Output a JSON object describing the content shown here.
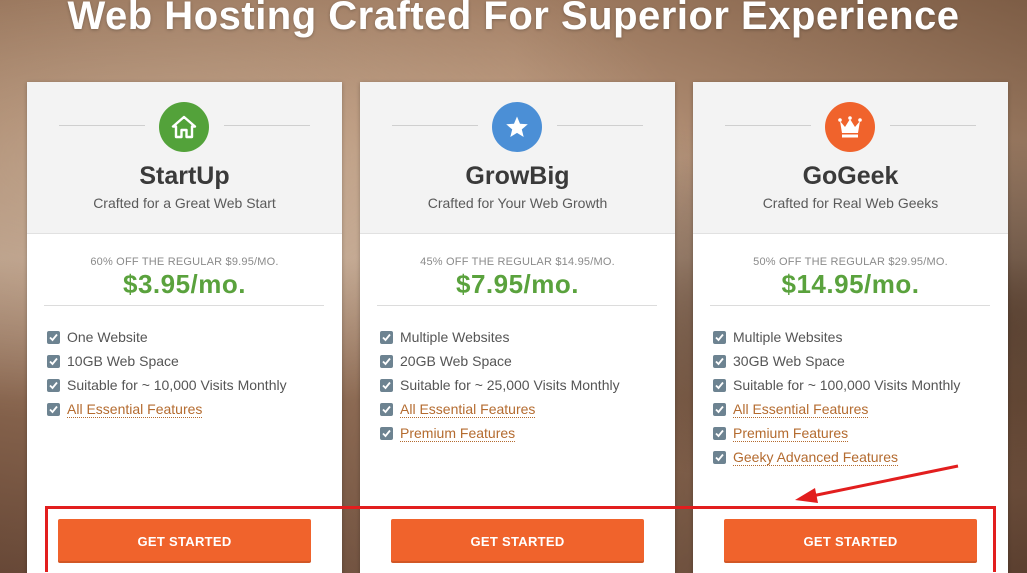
{
  "headline": "Web Hosting Crafted For Superior Experience",
  "colors": {
    "startup_icon": "#53a23a",
    "growbig_icon": "#4b8fd6",
    "gogeek_icon": "#f0632c",
    "price_green": "#5aa23d",
    "cta_orange": "#f0632c",
    "annotation_red": "#e21e1e"
  },
  "plans": [
    {
      "icon": "house-icon",
      "name": "StartUp",
      "tagline": "Crafted for a Great Web Start",
      "discount": "60% OFF THE REGULAR $9.95/MO.",
      "price": "$3.95/mo.",
      "features": [
        {
          "text": "One Website"
        },
        {
          "text": "10GB Web Space"
        },
        {
          "text": "Suitable for ~ 10,000 Visits Monthly"
        },
        {
          "text": "All Essential Features"
        }
      ],
      "cta": "GET STARTED"
    },
    {
      "icon": "star-icon",
      "name": "GrowBig",
      "tagline": "Crafted for Your Web Growth",
      "discount": "45% OFF THE REGULAR $14.95/MO.",
      "price": "$7.95/mo.",
      "features": [
        {
          "text": "Multiple Websites"
        },
        {
          "text": "20GB Web Space"
        },
        {
          "text": "Suitable for ~ 25,000 Visits Monthly"
        },
        {
          "text": "All Essential Features"
        },
        {
          "text": "Premium Features"
        }
      ],
      "cta": "GET STARTED"
    },
    {
      "icon": "crown-icon",
      "name": "GoGeek",
      "tagline": "Crafted for Real Web Geeks",
      "discount": "50% OFF THE REGULAR $29.95/MO.",
      "price": "$14.95/mo.",
      "features": [
        {
          "text": "Multiple Websites"
        },
        {
          "text": "30GB Web Space"
        },
        {
          "text": "Suitable for ~ 100,000 Visits Monthly"
        },
        {
          "text": "All Essential Features"
        },
        {
          "text": "Premium Features"
        },
        {
          "text": "Geeky Advanced Features"
        }
      ],
      "cta": "GET STARTED"
    }
  ]
}
